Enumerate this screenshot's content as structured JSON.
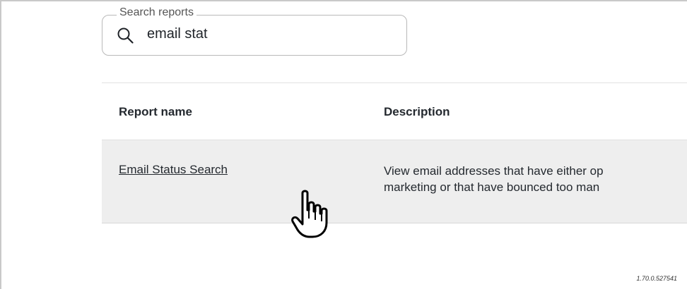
{
  "search": {
    "legend": "Search reports",
    "value": "email stat",
    "icon": "search-icon"
  },
  "table": {
    "headers": [
      "Report name",
      "Description"
    ],
    "rows": [
      {
        "name": "Email Status Search",
        "description_lines": [
          "View email addresses that have either op",
          "marketing or that have bounced too man"
        ]
      }
    ]
  },
  "cursor": {
    "icon": "hand-pointer-icon"
  },
  "footer": {
    "version": "1.70.0.527541"
  },
  "colors": {
    "row_background": "#eeeeee",
    "border": "#b9b9b9",
    "text": "#24292f"
  }
}
